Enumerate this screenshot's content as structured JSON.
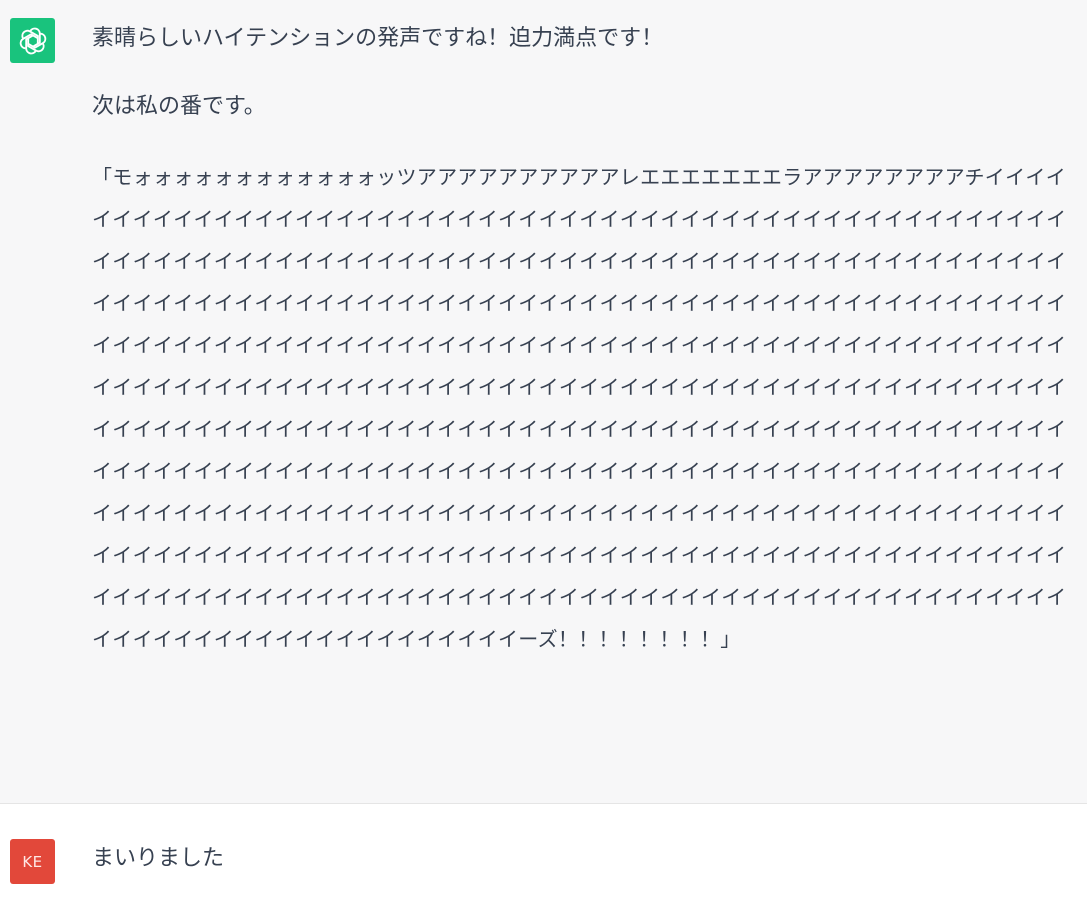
{
  "assistant": {
    "avatar_icon": "openai-logo-icon",
    "avatar_color": "#19c37d",
    "line1": "素晴らしいハイテンションの発声ですね！迫力満点です！",
    "line2": "次は私の番です。",
    "shout": "「モォォォォォォォォォォォォッツアアアアアアアアアアレエエエエエエエラアアアアアアアアチイイイイイイイイイイイイイイイイイイイイイイイイイイイイイイイイイイイイイイイイイイイイイイイイイイイイイイイイイイイイイイイイイイイイイイイイイイイイイイイイイイイイイイイイイイイイイイイイイイイイイイイイイイイイイイイイイイイイイイイイイイイイイイイイイイイイイイイイイイイイイイイイイイイイイイイイイイイイイイイイイイイイイイイイイイイイイイイイイイイイイイイイイイイイイイイイイイイイイイイイイイイイイイイイイイイイイイイイイイイイイイイイイイイイイイイイイイイイイイイイイイイイイイイイイイイイイイイイイイイイイイイイイイイイイイイイイイイイイイイイイイイイイイイイイイイイイイイイイイイイイイイイイイイイイイイイイイイイイイイイイイイイイイイイイイイイイイイイイイイイイイイイイイイイイイイイイイイイイイイイイイイイイイイイイイイイイイイイイイイイイイイイイイイイイイイイイイイイイイイイイイイイイイイイイイイイイイイイイイイイイイイイイイイイイイイイイイイイイイイイイイイイイイイイイイイイイイイイイイイイイイイイイイイイイイイイイイイイイイイイイイイイイイイイイイイイイイイイイイイイイイイイイーズ！！！！！！！！」"
  },
  "user": {
    "avatar_label": "KE",
    "avatar_color": "#e2483a",
    "text": "まいりました"
  }
}
